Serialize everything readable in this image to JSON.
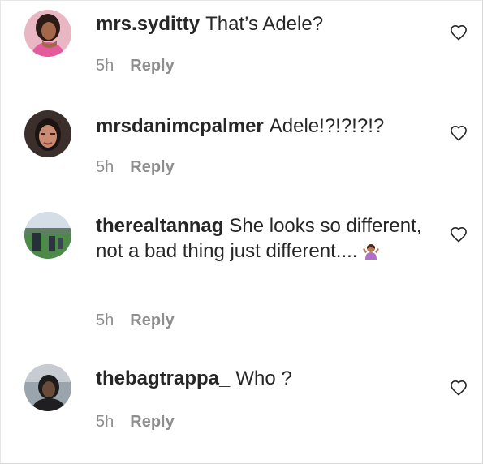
{
  "comments": [
    {
      "username": "mrs.syditty",
      "text": "That’s Adele?",
      "time": "5h",
      "reply_label": "Reply",
      "like_icon": "heart-outline-icon"
    },
    {
      "username": "mrsdanimcpalmer",
      "text": "Adele!?!?!?!?",
      "time": "5h",
      "reply_label": "Reply",
      "like_icon": "heart-outline-icon"
    },
    {
      "username": "therealtannag",
      "text": "She looks so different, not a bad thing just different....",
      "emoji": "shrug-emoji",
      "time": "5h",
      "reply_label": "Reply",
      "like_icon": "heart-outline-icon"
    },
    {
      "username": "thebagtrappa_",
      "text": "Who ?",
      "time": "5h",
      "reply_label": "Reply",
      "like_icon": "heart-outline-icon"
    }
  ],
  "colors": {
    "text": "#262626",
    "meta": "#8e8e8e",
    "background": "#ffffff"
  }
}
